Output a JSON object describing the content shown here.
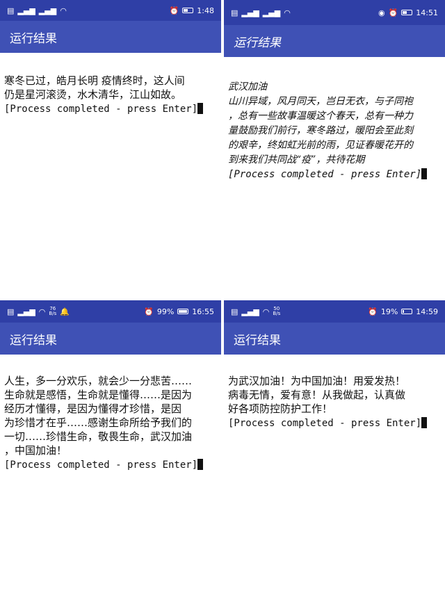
{
  "app_title": "运行结果",
  "colors": {
    "status_bar": "#2f3fa6",
    "app_bar": "#3f51b5",
    "background": "#ffffff",
    "text": "#111111"
  },
  "panels": [
    {
      "status": {
        "left_icons": [
          "hd-icon",
          "signal-icon",
          "signal-icon",
          "wifi-icon"
        ],
        "right_icons": [
          "alarm-icon"
        ],
        "battery_level": 0.5,
        "time": "1:48"
      },
      "lines": [
        "寒冬已过，皓月长明 疫情终时，这人间",
        "仍是星河滚烫，水木清华，江山如故。"
      ],
      "prompt": "[Process completed - press Enter]"
    },
    {
      "status": {
        "left_icons": [
          "hd-icon",
          "signal-icon",
          "signal-icon",
          "wifi-icon"
        ],
        "right_icons": [
          "eye-icon",
          "alarm-icon"
        ],
        "battery_level": 0.5,
        "time": "14:51"
      },
      "lines": [
        "武汉加油",
        "山川异域，风月同天，岂日无衣，与子同袍",
        "，总有一些故事温暖这个春天，总有一种力",
        "量鼓励我们前行，寒冬路过，暖阳会至此刻",
        "的艰辛，终如虹光前的雨，见证春暖花开的",
        "到来我们共同战“疫”，共待花期"
      ],
      "prompt": "[Process completed - press Enter]"
    },
    {
      "status": {
        "left_icons": [
          "hd-icon",
          "signal-icon",
          "wifi-icon"
        ],
        "net_speed": "76",
        "net_unit": "B/s",
        "right_icons": [
          "bell-icon",
          "alarm-icon"
        ],
        "battery_text": "99%",
        "battery_level": 0.99,
        "time": "16:55"
      },
      "lines": [
        "人生，多一分欢乐，就会少一分悲苦……",
        "生命就是感悟，生命就是懂得……是因为",
        "经历才懂得，是因为懂得才珍惜，是因",
        "为珍惜才在乎……感谢生命所给予我们的",
        "一切……珍惜生命，敬畏生命，武汉加油",
        "，中国加油！"
      ],
      "prompt": "[Process completed - press Enter]"
    },
    {
      "status": {
        "left_icons": [
          "hd-icon",
          "signal-icon",
          "wifi-icon"
        ],
        "net_speed": "50",
        "net_unit": "B/s",
        "right_icons": [
          "alarm-icon"
        ],
        "battery_text": "19%",
        "battery_level": 0.19,
        "time": "14:59"
      },
      "lines": [
        "为武汉加油！为中国加油！用爱发热！",
        "病毒无情，爱有意！从我做起，认真做",
        "好各项防控防护工作！"
      ],
      "prompt": "[Process completed - press Enter]"
    }
  ]
}
